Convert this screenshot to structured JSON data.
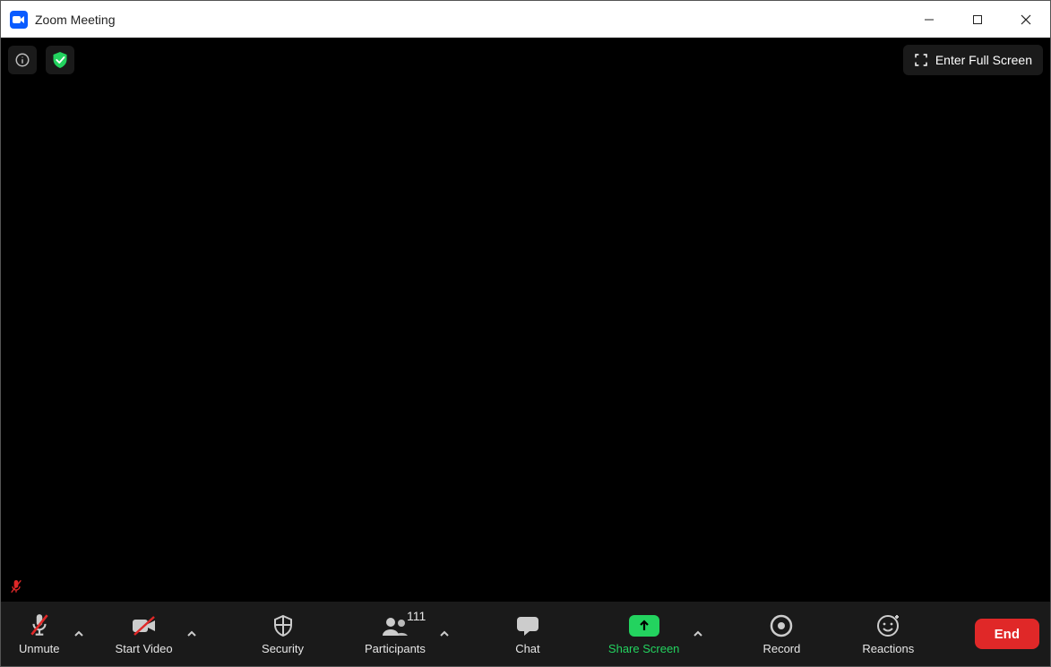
{
  "window": {
    "title": "Zoom Meeting"
  },
  "top": {
    "fullscreen_label": "Enter Full Screen"
  },
  "toolbar": {
    "unmute_label": "Unmute",
    "start_video_label": "Start Video",
    "security_label": "Security",
    "participants_label": "Participants",
    "participants_count": "111",
    "chat_label": "Chat",
    "share_screen_label": "Share Screen",
    "record_label": "Record",
    "reactions_label": "Reactions",
    "end_label": "End"
  }
}
